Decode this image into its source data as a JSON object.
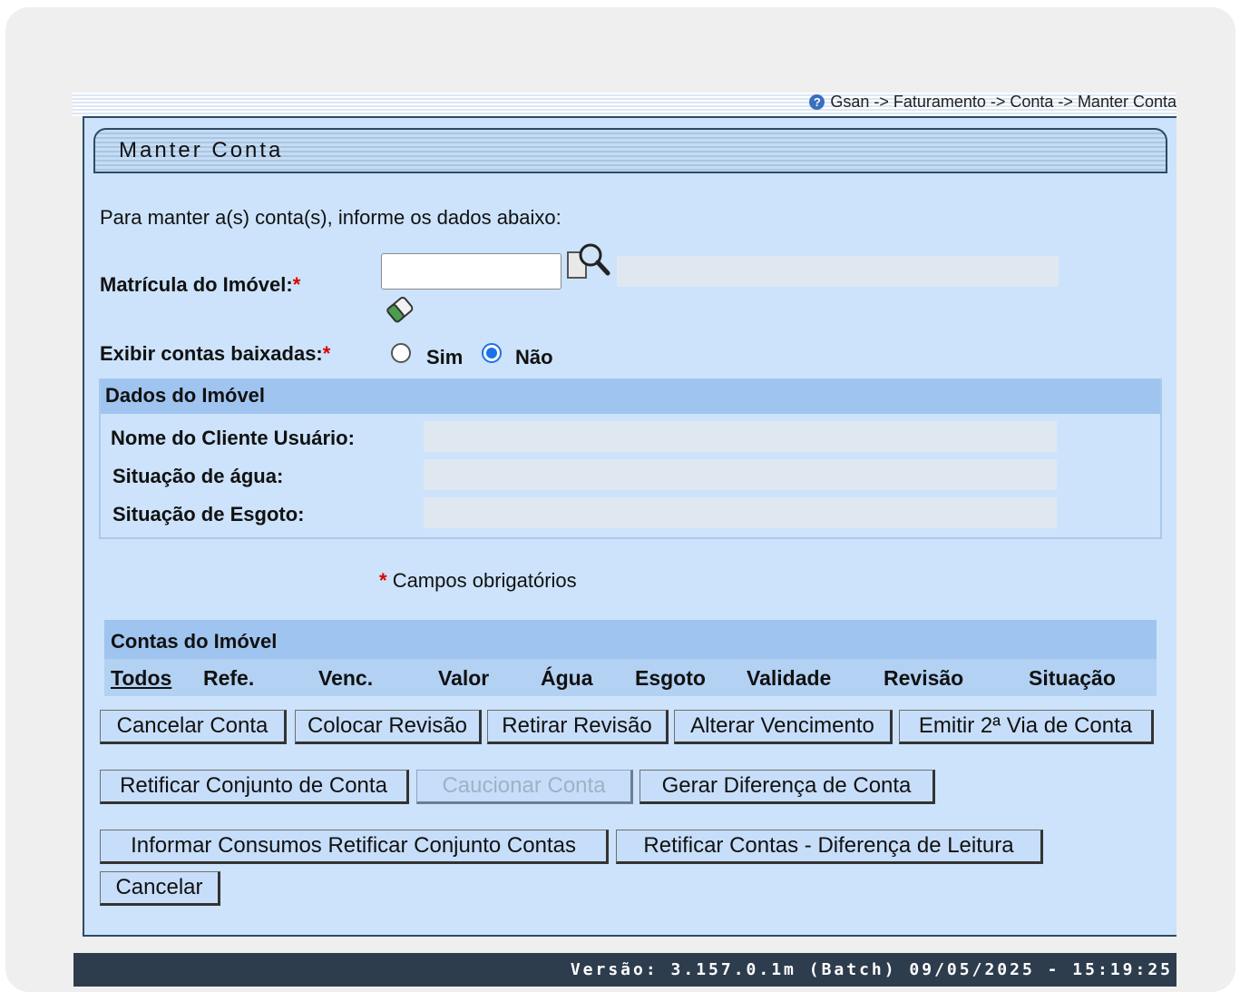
{
  "breadcrumb": {
    "help_glyph": "?",
    "text": "Gsan -> Faturamento -> Conta -> Manter Conta"
  },
  "page_title": "Manter Conta",
  "intro": "Para manter a(s) conta(s), informe os dados abaixo:",
  "matricula": {
    "label": "Matrícula do Imóvel:",
    "required": "*",
    "value": "",
    "description": ""
  },
  "exibir": {
    "label": "Exibir contas baixadas:",
    "required": "*",
    "options": [
      "Sim",
      "Não"
    ],
    "selected": "Não"
  },
  "dados_imovel": {
    "title": "Dados do Imóvel",
    "fields": [
      {
        "label": "Nome do Cliente Usuário:",
        "value": ""
      },
      {
        "label": "Situação de água:",
        "value": ""
      },
      {
        "label": "Situação de Esgoto:",
        "value": ""
      }
    ]
  },
  "required_note": {
    "mark": "*",
    "text": "Campos obrigatórios"
  },
  "contas": {
    "title": "Contas do Imóvel",
    "columns": [
      "Todos",
      "Refe.",
      "Venc.",
      "Valor",
      "Água",
      "Esgoto",
      "Validade",
      "Revisão",
      "Situação"
    ]
  },
  "buttons": {
    "cancelar_conta": "Cancelar Conta",
    "colocar_revisao": "Colocar Revisão",
    "retirar_revisao": "Retirar Revisão",
    "alterar_vencimento": "Alterar Vencimento",
    "emitir_2via": "Emitir 2ª Via de Conta",
    "retificar_conjunto": "Retificar Conjunto de Conta",
    "caucionar": "Caucionar Conta",
    "gerar_diferenca": "Gerar Diferença de Conta",
    "informar_consumos": "Informar Consumos Retificar Conjunto Contas",
    "retificar_diferenca_leitura": "Retificar Contas - Diferença de Leitura",
    "cancelar": "Cancelar"
  },
  "footer": "Versão: 3.157.0.1m (Batch) 09/05/2025 - 15:19:25",
  "colors": {
    "panel_bg": "#cce3fb",
    "section_header": "#9fc4ef",
    "footer_bg": "#2e3d4d",
    "required_mark": "#dd0000",
    "radio_selected": "#1a73e8"
  }
}
